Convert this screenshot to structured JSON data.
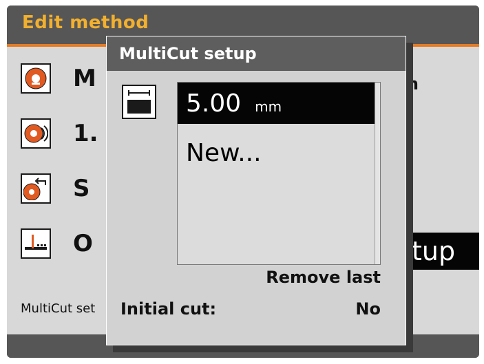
{
  "page": {
    "title": "Edit method",
    "rows": [
      {
        "text": "M",
        "icon": "saw-blade-icon"
      },
      {
        "text": "1.",
        "icon": "blade-speed-icon"
      },
      {
        "text": "S",
        "icon": "blade-return-icon"
      },
      {
        "text": "O",
        "icon": "multicut-icon"
      }
    ],
    "row1_value_fragment": "n",
    "highlight_row_text": "tup",
    "status_text": "MultiCut set"
  },
  "dialog": {
    "title": "MultiCut setup",
    "icon": "cut-thickness-icon",
    "list": [
      {
        "value": "5.00",
        "unit": "mm",
        "selected": true
      },
      {
        "value": "New...",
        "unit": "",
        "selected": false
      }
    ],
    "remove_last_label": "Remove last",
    "initial_cut_label": "Initial cut:",
    "initial_cut_value": "No"
  },
  "colors": {
    "title_accent": "#f2b02f",
    "header_rule": "#e57c25",
    "blade_orange": "#e05a22",
    "selection": "#050505"
  }
}
